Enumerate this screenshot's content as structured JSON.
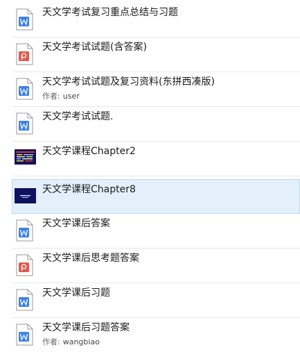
{
  "colors": {
    "doc_blue": "#3f82e0",
    "pdf_red": "#e05a4e",
    "selected_bg": "#e3f0fb"
  },
  "author_label": "作者:",
  "items": [
    {
      "title": "天文学考试复习重点总结与习题",
      "icon": "word-doc-icon",
      "author": ""
    },
    {
      "title": "天文学考试试题(含答案)",
      "icon": "pdf-doc-icon",
      "author": ""
    },
    {
      "title": "天文学考试试题及复习资料(东拼西凑版)",
      "icon": "word-doc-icon",
      "author": "user"
    },
    {
      "title": "天文学考试试题.",
      "icon": "word-doc-icon",
      "author": ""
    },
    {
      "title": "天文学课程Chapter2",
      "icon": "slide-thumbnail",
      "author": ""
    },
    {
      "title": "天文学课程Chapter8",
      "icon": "slide-thumbnail",
      "author": "",
      "selected": true
    },
    {
      "title": "天文学课后答案",
      "icon": "word-doc-icon",
      "author": ""
    },
    {
      "title": "天文学课后思考题答案",
      "icon": "pdf-doc-icon",
      "author": ""
    },
    {
      "title": "天文学课后习题",
      "icon": "word-doc-icon",
      "author": ""
    },
    {
      "title": "天文学课后习题答案",
      "icon": "word-doc-icon",
      "author": "wangbiao"
    }
  ]
}
